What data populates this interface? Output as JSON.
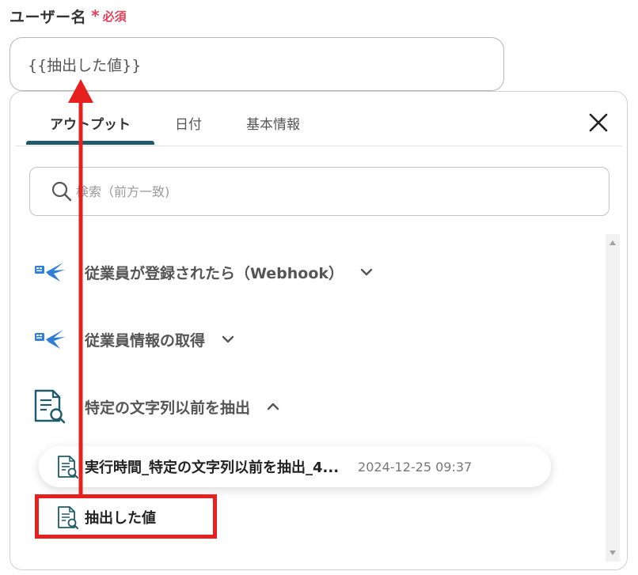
{
  "field": {
    "label": "ユーザー名",
    "required_mark": "*",
    "required_text": "必須",
    "value": "{{抽出した値}}"
  },
  "panel": {
    "tabs": [
      {
        "label": "アウトプット",
        "active": true
      },
      {
        "label": "日付",
        "active": false
      },
      {
        "label": "基本情報",
        "active": false
      }
    ],
    "search": {
      "placeholder": "検索（前方一致)"
    },
    "sections": [
      {
        "label": "従業員が登録されたら（Webhook）",
        "icon": "bird-app-icon",
        "expanded": false
      },
      {
        "label": "従業員情報の取得",
        "icon": "bird-app-icon",
        "expanded": false
      },
      {
        "label": "特定の文字列以前を抽出",
        "icon": "document-search-icon",
        "expanded": true
      }
    ],
    "items": [
      {
        "label": "実行時間_特定の文字列以前を抽出_4...",
        "time": "2024-12-25 09:37",
        "icon": "document-search-icon"
      },
      {
        "label": "抽出した値",
        "icon": "document-search-icon"
      }
    ]
  },
  "annotation": {
    "color": "#e5201f",
    "target": "抽出した値"
  },
  "colors": {
    "accent": "#1f5b6a",
    "required": "#e0405a",
    "annotation": "#e5201f",
    "bird_blue": "#2f7fd8"
  }
}
